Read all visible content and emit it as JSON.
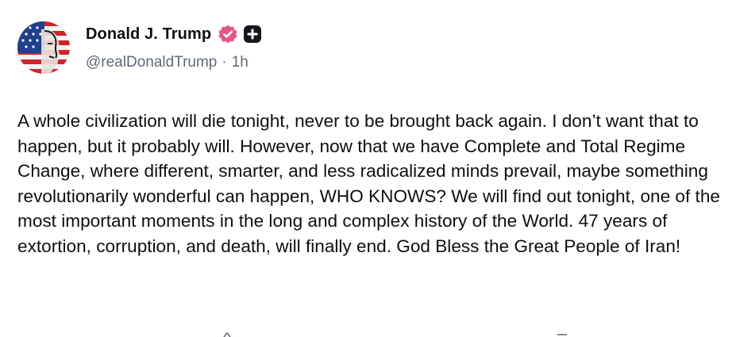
{
  "author": {
    "display_name": "Donald J. Trump",
    "handle": "@realDonaldTrump",
    "separator": "·",
    "time_ago": "1h",
    "avatar_icon": "avatar-flag-portrait",
    "verified_icon": "verified-badge-icon",
    "verified_color": "#e8548a",
    "extra_badge_icon": "plus-badge-icon"
  },
  "post": {
    "text": "A whole civilization will die tonight, never to be brought back again. I don’t want that to happen, but it probably will. However, now that we have Complete and Total Regime Change, where different, smarter, and less radicalized minds prevail, maybe something revolutionarily wonderful can happen, WHO KNOWS? We will find out tonight, one of the most important moments in the long and complex history of the World. 47 years of extortion, corruption, and death, will finally end. God Bless the Great People of Iran!"
  },
  "colors": {
    "text": "#0f0f14",
    "muted": "#606a78",
    "background": "#ffffff"
  }
}
